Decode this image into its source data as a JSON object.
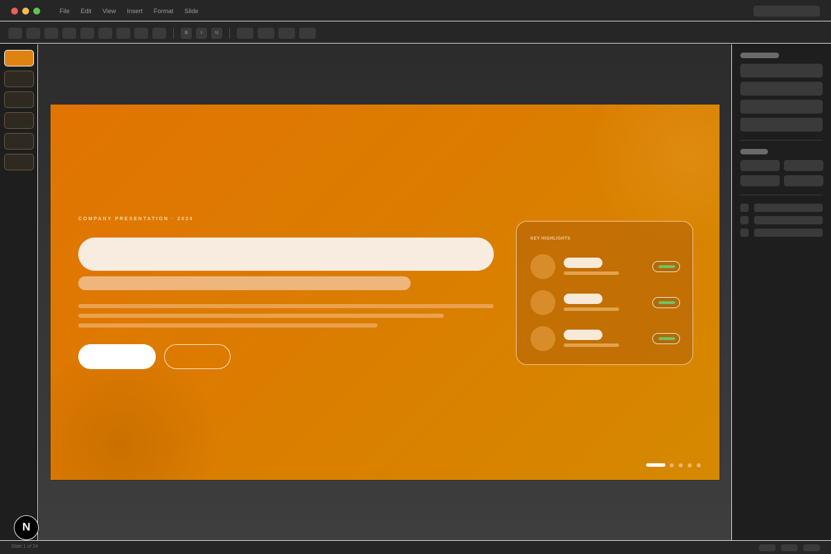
{
  "menu": {
    "items": [
      "File",
      "Edit",
      "View",
      "Insert",
      "Format",
      "Slide"
    ]
  },
  "toolbar": {
    "format_buttons": [
      "B",
      "I",
      "U"
    ]
  },
  "slide": {
    "eyebrow": "COMPANY PRESENTATION · 2024",
    "card": {
      "title": "KEY HIGHLIGHTS"
    },
    "pagination": {
      "total": 5,
      "current": 1
    }
  },
  "status": {
    "slide_counter": "Slide 1 of 24"
  },
  "logo": {
    "text": "N"
  },
  "colors": {
    "accent": "#de8311",
    "slide_start": "#e27402",
    "slide_end": "#d58900",
    "status_pill": "#73c361"
  }
}
